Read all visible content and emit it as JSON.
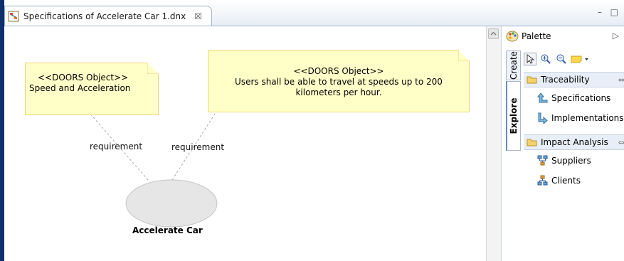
{
  "editor": {
    "tab_title": "Specifications of Accelerate Car 1.dnx",
    "close_glyph": "☒",
    "window_controls": "– □"
  },
  "diagram": {
    "note1": {
      "line1": "<<DOORS Object>>",
      "line2": "Speed and Acceleration"
    },
    "note2": {
      "line1": "<<DOORS Object>>",
      "line2": "Users shall be able to travel at speeds up to 200",
      "line3": "kilometers per hour."
    },
    "edge1_label": "requirement",
    "edge2_label": "requirement",
    "use_case_label": "Accelerate Car"
  },
  "palette": {
    "title": "Palette",
    "collapse_glyph": "▷",
    "tabs": {
      "create": "Create",
      "explore": "Explore"
    },
    "drawers": [
      {
        "label": "Traceability",
        "items": [
          {
            "label": "Specifications",
            "icon": "arrow-up-icon"
          },
          {
            "label": "Implementations",
            "icon": "arrow-down-icon"
          }
        ]
      },
      {
        "label": "Impact Analysis",
        "items": [
          {
            "label": "Suppliers",
            "icon": "hierarchy-down-icon"
          },
          {
            "label": "Clients",
            "icon": "hierarchy-up-icon"
          }
        ]
      }
    ],
    "pin_glyph": "⇔"
  },
  "colors": {
    "note_fill": "#ffffc8",
    "note_border": "#f0d27a",
    "usecase_fill": "#e6e6e6",
    "left_edge": "#0d2f6e"
  }
}
